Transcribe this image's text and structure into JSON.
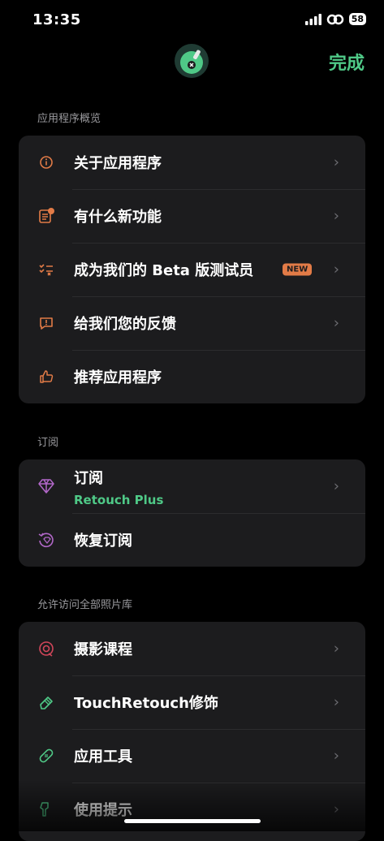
{
  "status": {
    "time": "13:35",
    "battery": "58"
  },
  "header": {
    "done": "完成"
  },
  "sections": {
    "overview_title": "应用程序概览",
    "overview": [
      {
        "label": "关于应用程序"
      },
      {
        "label": "有什么新功能"
      },
      {
        "label": "成为我们的 Beta 版测试员",
        "badge": "NEW"
      },
      {
        "label": "给我们您的反馈"
      },
      {
        "label": "推荐应用程序"
      }
    ],
    "subscription_title": "订阅",
    "subscription": [
      {
        "label": "订阅",
        "sub": "Retouch Plus"
      },
      {
        "label": "恢复订阅"
      }
    ],
    "library_title": "允许访问全部照片库",
    "library": [
      {
        "label": "摄影课程"
      },
      {
        "label": "TouchRetouch修饰"
      },
      {
        "label": "应用工具"
      },
      {
        "label": "使用提示"
      }
    ]
  },
  "colors": {
    "accent": "#4fc987",
    "orange": "#e27b47",
    "purple": "#b167c8",
    "card": "#1c1c1e"
  }
}
